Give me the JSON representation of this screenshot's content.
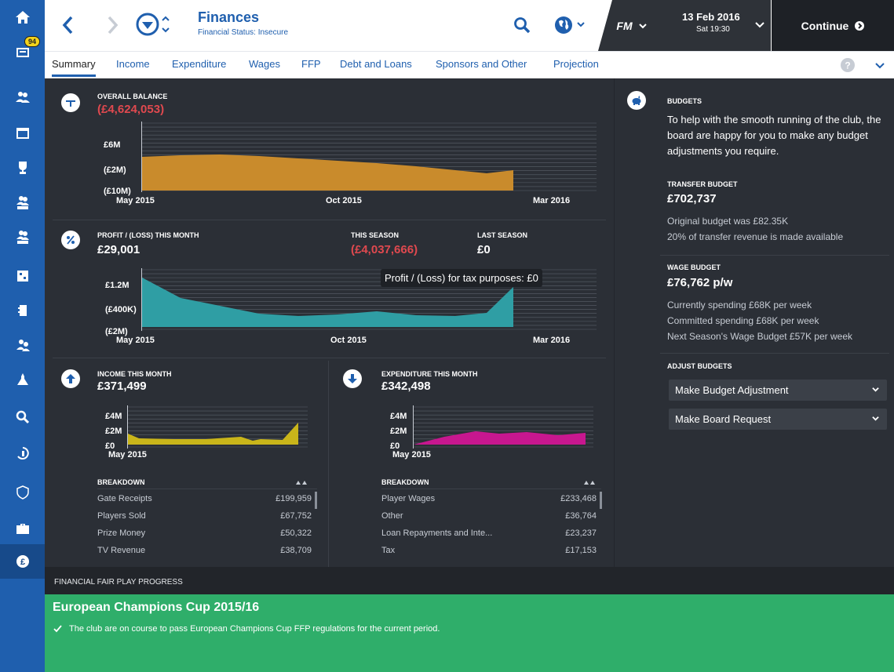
{
  "sidebar": {
    "badge_count": "94",
    "items": [
      "home-icon",
      "inbox-icon",
      "squad-icon",
      "schedule-icon",
      "trophy-icon",
      "u21-icon",
      "u18-icon",
      "tactics-icon",
      "training-icon",
      "scouting-icon",
      "staff-icon",
      "search-icon",
      "transfers-icon",
      "club-vision-icon",
      "finances-icon",
      "money-icon"
    ]
  },
  "header": {
    "title": "Finances",
    "subtitle": "Financial Status: Insecure",
    "fm_label": "FM",
    "date": "13 Feb 2016",
    "time": "Sat 19:30",
    "continue_label": "Continue"
  },
  "tabs": [
    "Summary",
    "Income",
    "Expenditure",
    "Wages",
    "FFP",
    "Debt and Loans",
    "Sponsors and Other",
    "Projection"
  ],
  "overall": {
    "label": "OVERALL BALANCE",
    "value": "(£4,624,053)",
    "y_ticks": [
      "£6M",
      "(£2M)",
      "(£10M)"
    ],
    "x_ticks": [
      "May 2015",
      "Oct 2015",
      "Mar 2016"
    ]
  },
  "profit": {
    "label": "PROFIT / (LOSS) THIS MONTH",
    "value": "£29,001",
    "season_label": "THIS SEASON",
    "season_value": "(£4,037,666)",
    "last_label": "LAST SEASON",
    "last_value": "£0",
    "y_ticks": [
      "£1.2M",
      "(£400K)",
      "(£2M)"
    ],
    "x_ticks": [
      "May 2015",
      "Oct 2015",
      "Mar 2016"
    ],
    "tooltip": "Profit / (Loss) for tax purposes: £0"
  },
  "income": {
    "label": "INCOME THIS MONTH",
    "value": "£371,499",
    "y_ticks": [
      "£4M",
      "£2M",
      "£0"
    ],
    "x_tick": "May 2015",
    "breakdown_label": "BREAKDOWN",
    "rows": [
      {
        "name": "Gate Receipts",
        "value": "£199,959"
      },
      {
        "name": "Players Sold",
        "value": "£67,752"
      },
      {
        "name": "Prize Money",
        "value": "£50,322"
      },
      {
        "name": "TV Revenue",
        "value": "£38,709"
      }
    ]
  },
  "expenditure": {
    "label": "EXPENDITURE THIS MONTH",
    "value": "£342,498",
    "y_ticks": [
      "£4M",
      "£2M",
      "£0"
    ],
    "x_tick": "May 2015",
    "breakdown_label": "BREAKDOWN",
    "rows": [
      {
        "name": "Player Wages",
        "value": "£233,468"
      },
      {
        "name": "Other",
        "value": "£36,764"
      },
      {
        "name": "Loan Repayments and Inte...",
        "value": "£23,237"
      },
      {
        "name": "Tax",
        "value": "£17,153"
      }
    ]
  },
  "budgets": {
    "heading": "BUDGETS",
    "intro": "To help with the smooth running of the club, the board are happy for you to make any budget adjustments you require.",
    "transfer_label": "TRANSFER BUDGET",
    "transfer_value": "£702,737",
    "transfer_note1": "Original budget was £82.35K",
    "transfer_note2": "20% of transfer revenue is made available",
    "wage_label": "WAGE BUDGET",
    "wage_value": "£76,762 p/w",
    "wage_note1": "Currently spending £68K per week",
    "wage_note2": "Committed spending £68K per week",
    "wage_note3": "Next Season's Wage Budget £57K per week",
    "adjust_label": "ADJUST BUDGETS",
    "button1": "Make Budget Adjustment",
    "button2": "Make Board Request"
  },
  "ffp": {
    "heading": "FINANCIAL FAIR PLAY PROGRESS",
    "title": "European Champions Cup 2015/16",
    "message": "The club are on course to pass European Champions Cup FFP regulations for the current period."
  },
  "colors": {
    "accent": "#1f5fae",
    "balance_fill": "#c98b2c",
    "profit_fill": "#2f9ea4",
    "income_fill": "#c9b51a",
    "expenditure_fill": "#c7178f",
    "ffp_green": "#2fae6a",
    "negative": "#e0494f"
  }
}
